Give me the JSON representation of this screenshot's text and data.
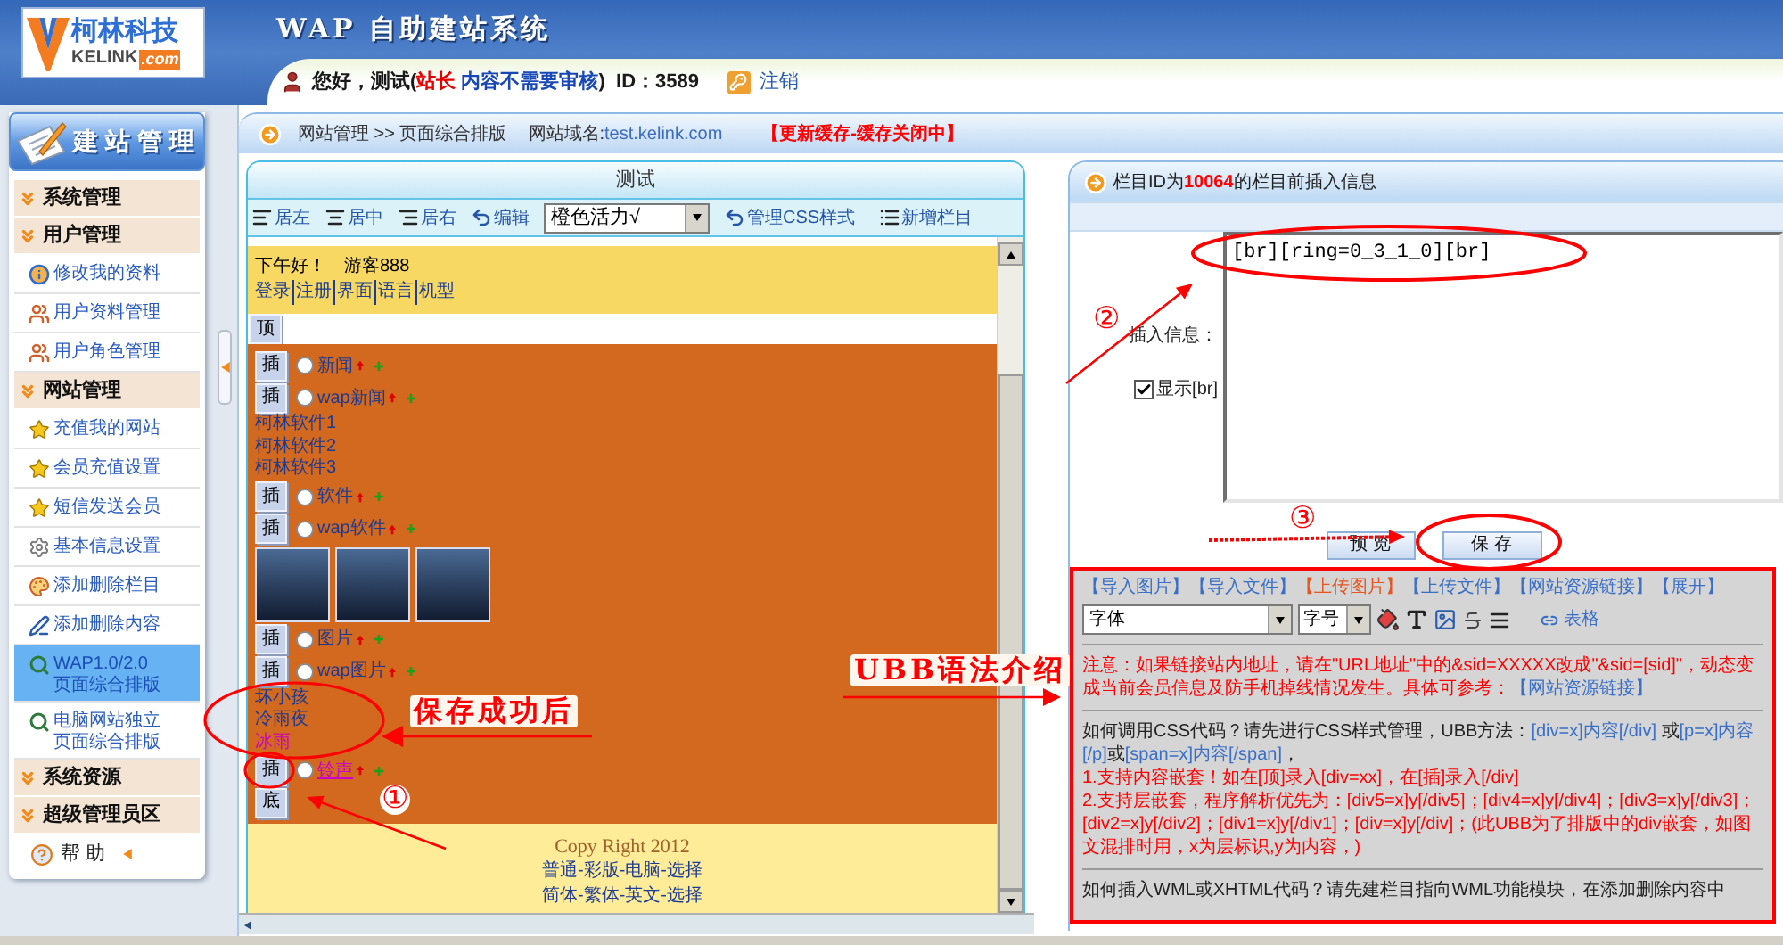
{
  "header": {
    "logo": {
      "name": "柯林科技",
      "brand": "KELINK",
      "suffix": ".com"
    },
    "title": "WAP 自助建站系统",
    "user_info": [
      {
        "kind": "plain",
        "text": "您好，测试("
      },
      {
        "kind": "role",
        "text": "站长"
      },
      {
        "kind": "note",
        "text": " 内容不需要审核"
      },
      {
        "kind": "plain",
        "text": ")  ID：3589"
      }
    ],
    "logout": "注销"
  },
  "sidebar": {
    "title": "建站管理",
    "sections": [
      {
        "label": "系统管理"
      },
      {
        "label": "用户管理",
        "items": [
          {
            "kind": "profile",
            "label": "修改我的资料",
            "selected": false
          },
          {
            "kind": "users",
            "label": "用户资料管理",
            "selected": false
          },
          {
            "kind": "users",
            "label": "用户角色管理",
            "selected": false
          }
        ]
      },
      {
        "label": "网站管理",
        "items": [
          {
            "kind": "star",
            "label": "充值我的网站",
            "selected": false
          },
          {
            "kind": "star",
            "label": "会员充值设置",
            "selected": false
          },
          {
            "kind": "star",
            "label": "短信发送会员",
            "selected": false
          },
          {
            "kind": "gear",
            "label": "基本信息设置",
            "selected": false
          },
          {
            "kind": "palette",
            "label": "添加删除栏目",
            "selected": false
          },
          {
            "kind": "pen",
            "label": "添加删除内容",
            "selected": false
          },
          {
            "kind": "layout",
            "label": "WAP1.0/2.0 页面综合排版",
            "selected": true
          },
          {
            "kind": "layout",
            "label": "电脑网站独立页面综合排版",
            "selected": false
          }
        ]
      },
      {
        "label": "系统资源"
      },
      {
        "label": "超级管理员区"
      }
    ],
    "help": "帮 助"
  },
  "breadcrumb": {
    "path": "网站管理 >> 页面综合排版",
    "domain_label": "网站域名:",
    "domain": "test.kelink.com",
    "cache_status": "【更新缓存-缓存关闭中】"
  },
  "layout_panel": {
    "title": "测试",
    "toolbar": [
      {
        "kind": "align-left",
        "label": "居左"
      },
      {
        "kind": "align-center",
        "label": "居中"
      },
      {
        "kind": "align-right",
        "label": "居右"
      },
      {
        "kind": "edit",
        "label": "编辑"
      },
      {
        "kind": "select",
        "value": "橙色活力√"
      },
      {
        "kind": "css",
        "label": "管理CSS样式"
      },
      {
        "kind": "add",
        "label": "新增栏目"
      }
    ],
    "preview": {
      "greeting": "下午好！",
      "visitor": "游客888",
      "nav": [
        "登录",
        "注册",
        "界面",
        "语言",
        "机型"
      ],
      "top_button": "顶",
      "rows": [
        {
          "kind": "column",
          "button": "插",
          "label": "新闻",
          "selected": false,
          "visited": false,
          "hovered": false
        },
        {
          "kind": "column",
          "button": "插",
          "label": "wap新闻",
          "selected": false,
          "visited": false,
          "hovered": false
        },
        {
          "kind": "text",
          "text": "柯林软件1",
          "visited": false
        },
        {
          "kind": "text",
          "text": "柯林软件2",
          "visited": false
        },
        {
          "kind": "text",
          "text": "柯林软件3",
          "visited": false
        },
        {
          "kind": "column",
          "button": "插",
          "label": "软件",
          "selected": false,
          "visited": false,
          "hovered": false
        },
        {
          "kind": "column",
          "button": "插",
          "label": "wap软件",
          "selected": false,
          "visited": false,
          "hovered": false
        },
        {
          "kind": "images",
          "images": [
            {
              "kind": "photo"
            },
            {
              "kind": "photo"
            },
            {
              "kind": "photo"
            }
          ]
        },
        {
          "kind": "column",
          "button": "插",
          "label": "图片",
          "selected": false,
          "visited": false,
          "hovered": false
        },
        {
          "kind": "column",
          "button": "插",
          "label": "wap图片",
          "selected": false,
          "visited": false,
          "hovered": false
        },
        {
          "kind": "text",
          "text": "坏小孩",
          "visited": false
        },
        {
          "kind": "text",
          "text": "冷雨夜",
          "visited": false
        },
        {
          "kind": "text",
          "text": "冰雨",
          "visited": true
        },
        {
          "kind": "column",
          "button": "插",
          "label": "铃声",
          "selected": false,
          "visited": true,
          "hovered": true
        },
        {
          "kind": "bottom",
          "button": "底"
        }
      ],
      "footer": {
        "copyright": "Copy Right 2012",
        "links": [
          "普通-彩版-电脑-选择",
          "简体-繁体-英文-选择"
        ]
      }
    }
  },
  "insert_panel": {
    "title": "栏目ID为**10064**的栏目前插入信息",
    "field_label": "插入信息：",
    "show_br": {
      "label": "显示[br]",
      "checked": true
    },
    "value": "[br][ring=0_3_1_0][br]",
    "buttons": [
      {
        "kind": "preview",
        "label": "预 览"
      },
      {
        "kind": "save",
        "label": "保 存"
      }
    ]
  },
  "ubb_help": {
    "links": [
      {
        "text": "【导入图片】",
        "highlighted": false
      },
      {
        "text": "【导入文件】",
        "highlighted": false
      },
      {
        "text": "【上传图片】",
        "highlighted": true
      },
      {
        "text": "【上传文件】",
        "highlighted": false
      },
      {
        "text": "【网站资源链接】",
        "highlighted": false
      },
      {
        "text": "【展开】",
        "highlighted": false
      }
    ],
    "font_select": "字体",
    "size_select": "字号",
    "table_link": "表格",
    "notice": [
      {
        "kind": "warning",
        "text": "注意：如果链接站内地址，请在\"URL地址\"中的&sid=XXXXX改成\"&sid=[sid]\"，动态变成当前会员信息及防手机掉线情况发生。具体可参考："
      },
      {
        "kind": "link",
        "text": "【网站资源链接】"
      }
    ],
    "css_help": [
      {
        "kind": "plain",
        "text": "如何调用CSS代码？请先进行CSS样式管理，UBB方法："
      },
      {
        "kind": "code",
        "text": "[div=x]内容[/div]"
      },
      {
        "kind": "plain",
        "text": " 或"
      },
      {
        "kind": "code",
        "text": "[p=x]内容[/p]"
      },
      {
        "kind": "plain",
        "text": "或"
      },
      {
        "kind": "code",
        "text": "[span=x]内容[/span]"
      },
      {
        "kind": "plain",
        "text": "，"
      }
    ],
    "rules": [
      "1.支持内容嵌套！如在[顶]录入[div=xx]，在[插]录入[/div]",
      "2.支持层嵌套，程序解析优先为：[div5=x]y[/div5]；[div4=x]y[/div4]；[div3=x]y[/div3]；[div2=x]y[/div2]；[div1=x]y[/div1]；[div=x]y[/div]；(此UBB为了排版中的div嵌套，如图文混排时用，x为层标识,y为内容，)"
    ],
    "more": "如何插入WML或XHTML代码？请先建栏目指向WML功能模块，在添加删除内容中"
  },
  "annotations": [
    {
      "kind": "caption",
      "text": "保存成功后"
    },
    {
      "kind": "caption",
      "text": "UBB语法介绍"
    },
    {
      "kind": "step",
      "text": "①"
    },
    {
      "kind": "step",
      "text": "②"
    },
    {
      "kind": "step",
      "text": "③"
    }
  ]
}
